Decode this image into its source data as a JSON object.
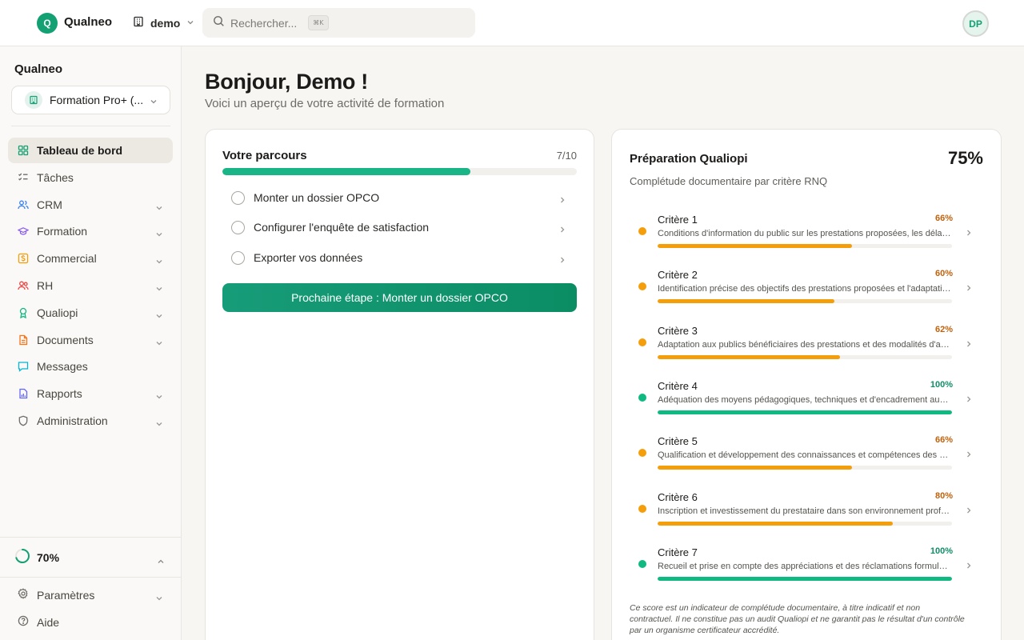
{
  "topbar": {
    "logo_letter": "Q",
    "app_name": "Qualneo",
    "workspace": "demo",
    "search_placeholder": "Rechercher...",
    "search_shortcut": "⌘K",
    "avatar_initials": "DP"
  },
  "sidebar": {
    "title": "Qualneo",
    "organization": "Formation Pro+ (...",
    "items": [
      {
        "label": "Tableau de bord",
        "icon": "dashboard-icon",
        "active": true,
        "expandable": false
      },
      {
        "label": "Tâches",
        "icon": "tasks-icon",
        "active": false,
        "expandable": false
      },
      {
        "label": "CRM",
        "icon": "users-icon",
        "active": false,
        "expandable": true
      },
      {
        "label": "Formation",
        "icon": "graduation-cap-icon",
        "active": false,
        "expandable": true
      },
      {
        "label": "Commercial",
        "icon": "dollar-icon",
        "active": false,
        "expandable": true
      },
      {
        "label": "RH",
        "icon": "people-icon",
        "active": false,
        "expandable": true
      },
      {
        "label": "Qualiopi",
        "icon": "award-icon",
        "active": false,
        "expandable": true
      },
      {
        "label": "Documents",
        "icon": "document-icon",
        "active": false,
        "expandable": true
      },
      {
        "label": "Messages",
        "icon": "message-icon",
        "active": false,
        "expandable": false
      },
      {
        "label": "Rapports",
        "icon": "report-icon",
        "active": false,
        "expandable": true
      },
      {
        "label": "Administration",
        "icon": "shield-icon",
        "active": false,
        "expandable": true
      }
    ],
    "progress_value": 0.7,
    "progress_label": "70%",
    "settings_label": "Paramètres",
    "help_label": "Aide"
  },
  "main": {
    "greeting": "Bonjour, Demo !",
    "subtitle": "Voici un aperçu de votre activité de formation"
  },
  "parcours": {
    "title": "Votre parcours",
    "count": "7/10",
    "progress": 0.7,
    "tasks": [
      "Monter un dossier OPCO",
      "Configurer l'enquête de satisfaction",
      "Exporter vos données"
    ],
    "cta": "Prochaine étape : Monter un dossier OPCO"
  },
  "qualiopi": {
    "title": "Préparation Qualiopi",
    "percent": "75%",
    "subtitle": "Complétude documentaire par critère RNQ",
    "criteria": [
      {
        "name": "Critère 1",
        "percent": "66%",
        "value": 66,
        "status": "partial",
        "description": "Conditions d'information du public sur les prestations proposées, les délais pour y accéder et les résultats obtenus"
      },
      {
        "name": "Critère 2",
        "percent": "60%",
        "value": 60,
        "status": "partial",
        "description": "Identification précise des objectifs des prestations proposées et l'adaptation de ces prestations aux publics bénéficiaires"
      },
      {
        "name": "Critère 3",
        "percent": "62%",
        "value": 62,
        "status": "partial",
        "description": "Adaptation aux publics bénéficiaires des prestations et des modalités d'accueil, d'accompagnement, de suivi et d'évaluation"
      },
      {
        "name": "Critère 4",
        "percent": "100%",
        "value": 100,
        "status": "complete",
        "description": "Adéquation des moyens pédagogiques, techniques et d'encadrement aux prestations mises en œuvre"
      },
      {
        "name": "Critère 5",
        "percent": "66%",
        "value": 66,
        "status": "partial",
        "description": "Qualification et développement des connaissances et compétences des personnels chargés de mettre en œuvre les prestations"
      },
      {
        "name": "Critère 6",
        "percent": "80%",
        "value": 80,
        "status": "partial",
        "description": "Inscription et investissement du prestataire dans son environnement professionnel"
      },
      {
        "name": "Critère 7",
        "percent": "100%",
        "value": 100,
        "status": "complete",
        "description": "Recueil et prise en compte des appréciations et des réclamations formulées par les parties prenantes"
      }
    ],
    "disclaimer": "Ce score est un indicateur de complétude documentaire, à titre indicatif et non contractuel. Il ne constitue pas un audit Qualiopi et ne garantit pas le résultat d'un contrôle par un organisme certificateur accrédité."
  },
  "colors": {
    "accent": "#13a072",
    "partial": "#f59e0b",
    "complete": "#10b981",
    "partial_text": "#c2620c",
    "complete_text": "#0f8f67"
  }
}
